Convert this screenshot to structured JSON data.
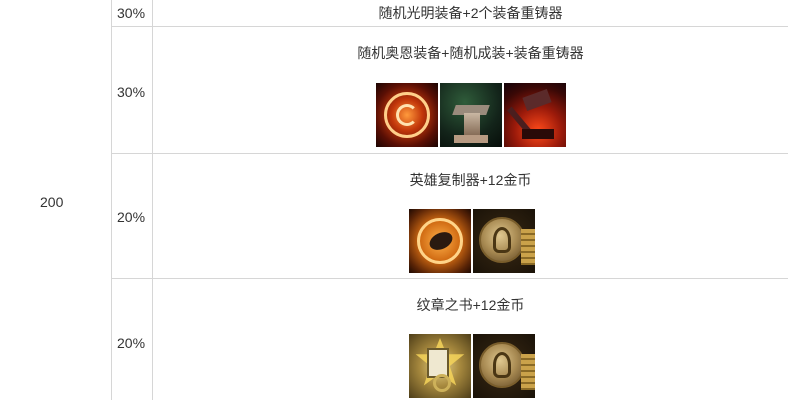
{
  "left_group": {
    "label": "200"
  },
  "rows": [
    {
      "rate": "30%",
      "reward": "随机光明装备+2个装备重铸器",
      "icons": []
    },
    {
      "rate": "30%",
      "reward": "随机奥恩装备+随机成装+装备重铸器",
      "icons": [
        "ornn-orb-icon",
        "anvil-icon",
        "forge-hammer-icon"
      ]
    },
    {
      "rate": "20%",
      "reward": "英雄复制器+12金币",
      "icons": [
        "champion-duplicator-icon",
        "gold-coin-icon"
      ]
    },
    {
      "rate": "20%",
      "reward": "纹章之书+12金币",
      "icons": [
        "emblem-tome-icon",
        "gold-coin-icon"
      ]
    }
  ]
}
